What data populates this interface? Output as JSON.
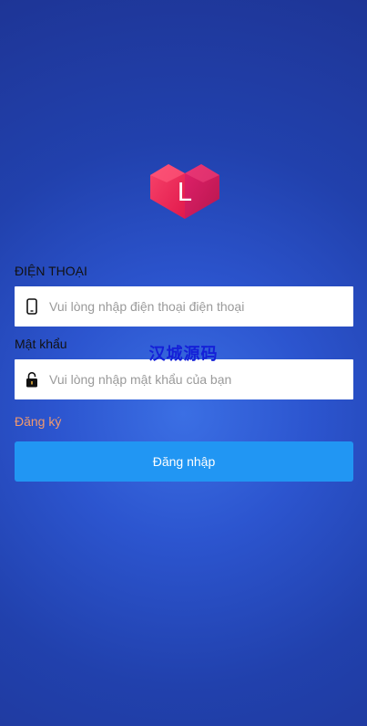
{
  "logo": {
    "letter": "L",
    "icon": "heart-logo-icon",
    "colors": [
      "#f0385c",
      "#e8184f",
      "#c9165a"
    ]
  },
  "phone_field": {
    "label": "ĐIỆN THOẠI",
    "placeholder": "Vui lòng nhập điện thoại điện thoại",
    "icon": "phone-icon"
  },
  "password_field": {
    "label": "Mật khẩu",
    "placeholder": "Vui lòng nhập mật khẩu của bạn",
    "icon": "lock-icon"
  },
  "register": {
    "label": "Đăng ký",
    "color": "#f29a6e"
  },
  "login_button": {
    "label": "Đăng nhập",
    "color": "#2196f3"
  },
  "watermark": {
    "text": "汉城源码"
  }
}
